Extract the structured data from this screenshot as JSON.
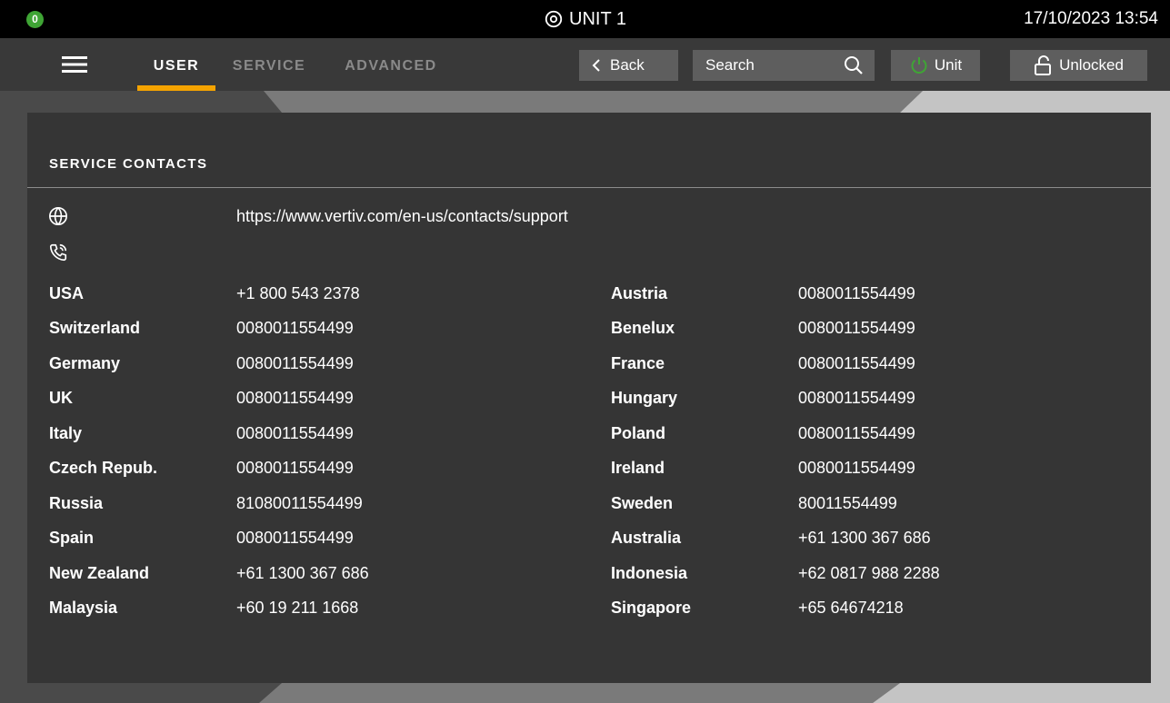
{
  "status_bar": {
    "alarm_count": "0",
    "unit_name": "UNIT 1",
    "datetime": "17/10/2023 13:54"
  },
  "nav": {
    "tabs": [
      {
        "label": "USER",
        "active": true
      },
      {
        "label": "SERVICE",
        "active": false
      },
      {
        "label": "ADVANCED",
        "active": false
      }
    ],
    "back_label": "Back",
    "search_placeholder": "Search",
    "unit_label": "Unit",
    "lock_label": "Unlocked"
  },
  "panel": {
    "title": "SERVICE CONTACTS",
    "website": "https://www.vertiv.com/en-us/contacts/support",
    "contacts_left": [
      {
        "country": "USA",
        "number": "+1 800 543 2378"
      },
      {
        "country": "Switzerland",
        "number": "0080011554499"
      },
      {
        "country": "Germany",
        "number": "0080011554499"
      },
      {
        "country": "UK",
        "number": "0080011554499"
      },
      {
        "country": "Italy",
        "number": "0080011554499"
      },
      {
        "country": "Czech Repub.",
        "number": "0080011554499"
      },
      {
        "country": "Russia",
        "number": "81080011554499"
      },
      {
        "country": "Spain",
        "number": "0080011554499"
      },
      {
        "country": "New Zealand",
        "number": "+61 1300 367 686"
      },
      {
        "country": "Malaysia",
        "number": "+60 19 211 1668"
      }
    ],
    "contacts_right": [
      {
        "country": "Austria",
        "number": "0080011554499"
      },
      {
        "country": "Benelux",
        "number": "0080011554499"
      },
      {
        "country": "France",
        "number": "0080011554499"
      },
      {
        "country": "Hungary",
        "number": "0080011554499"
      },
      {
        "country": "Poland",
        "number": "0080011554499"
      },
      {
        "country": "Ireland",
        "number": "0080011554499"
      },
      {
        "country": "Sweden",
        "number": "80011554499"
      },
      {
        "country": "Australia",
        "number": "+61 1300 367 686"
      },
      {
        "country": "Indonesia",
        "number": "+62 0817 988 2288"
      },
      {
        "country": "Singapore",
        "number": "+65 64674218"
      }
    ]
  },
  "colors": {
    "accent_tab": "#f4a300",
    "alarm_badge": "#3fa535",
    "power_icon": "#3fa535"
  }
}
